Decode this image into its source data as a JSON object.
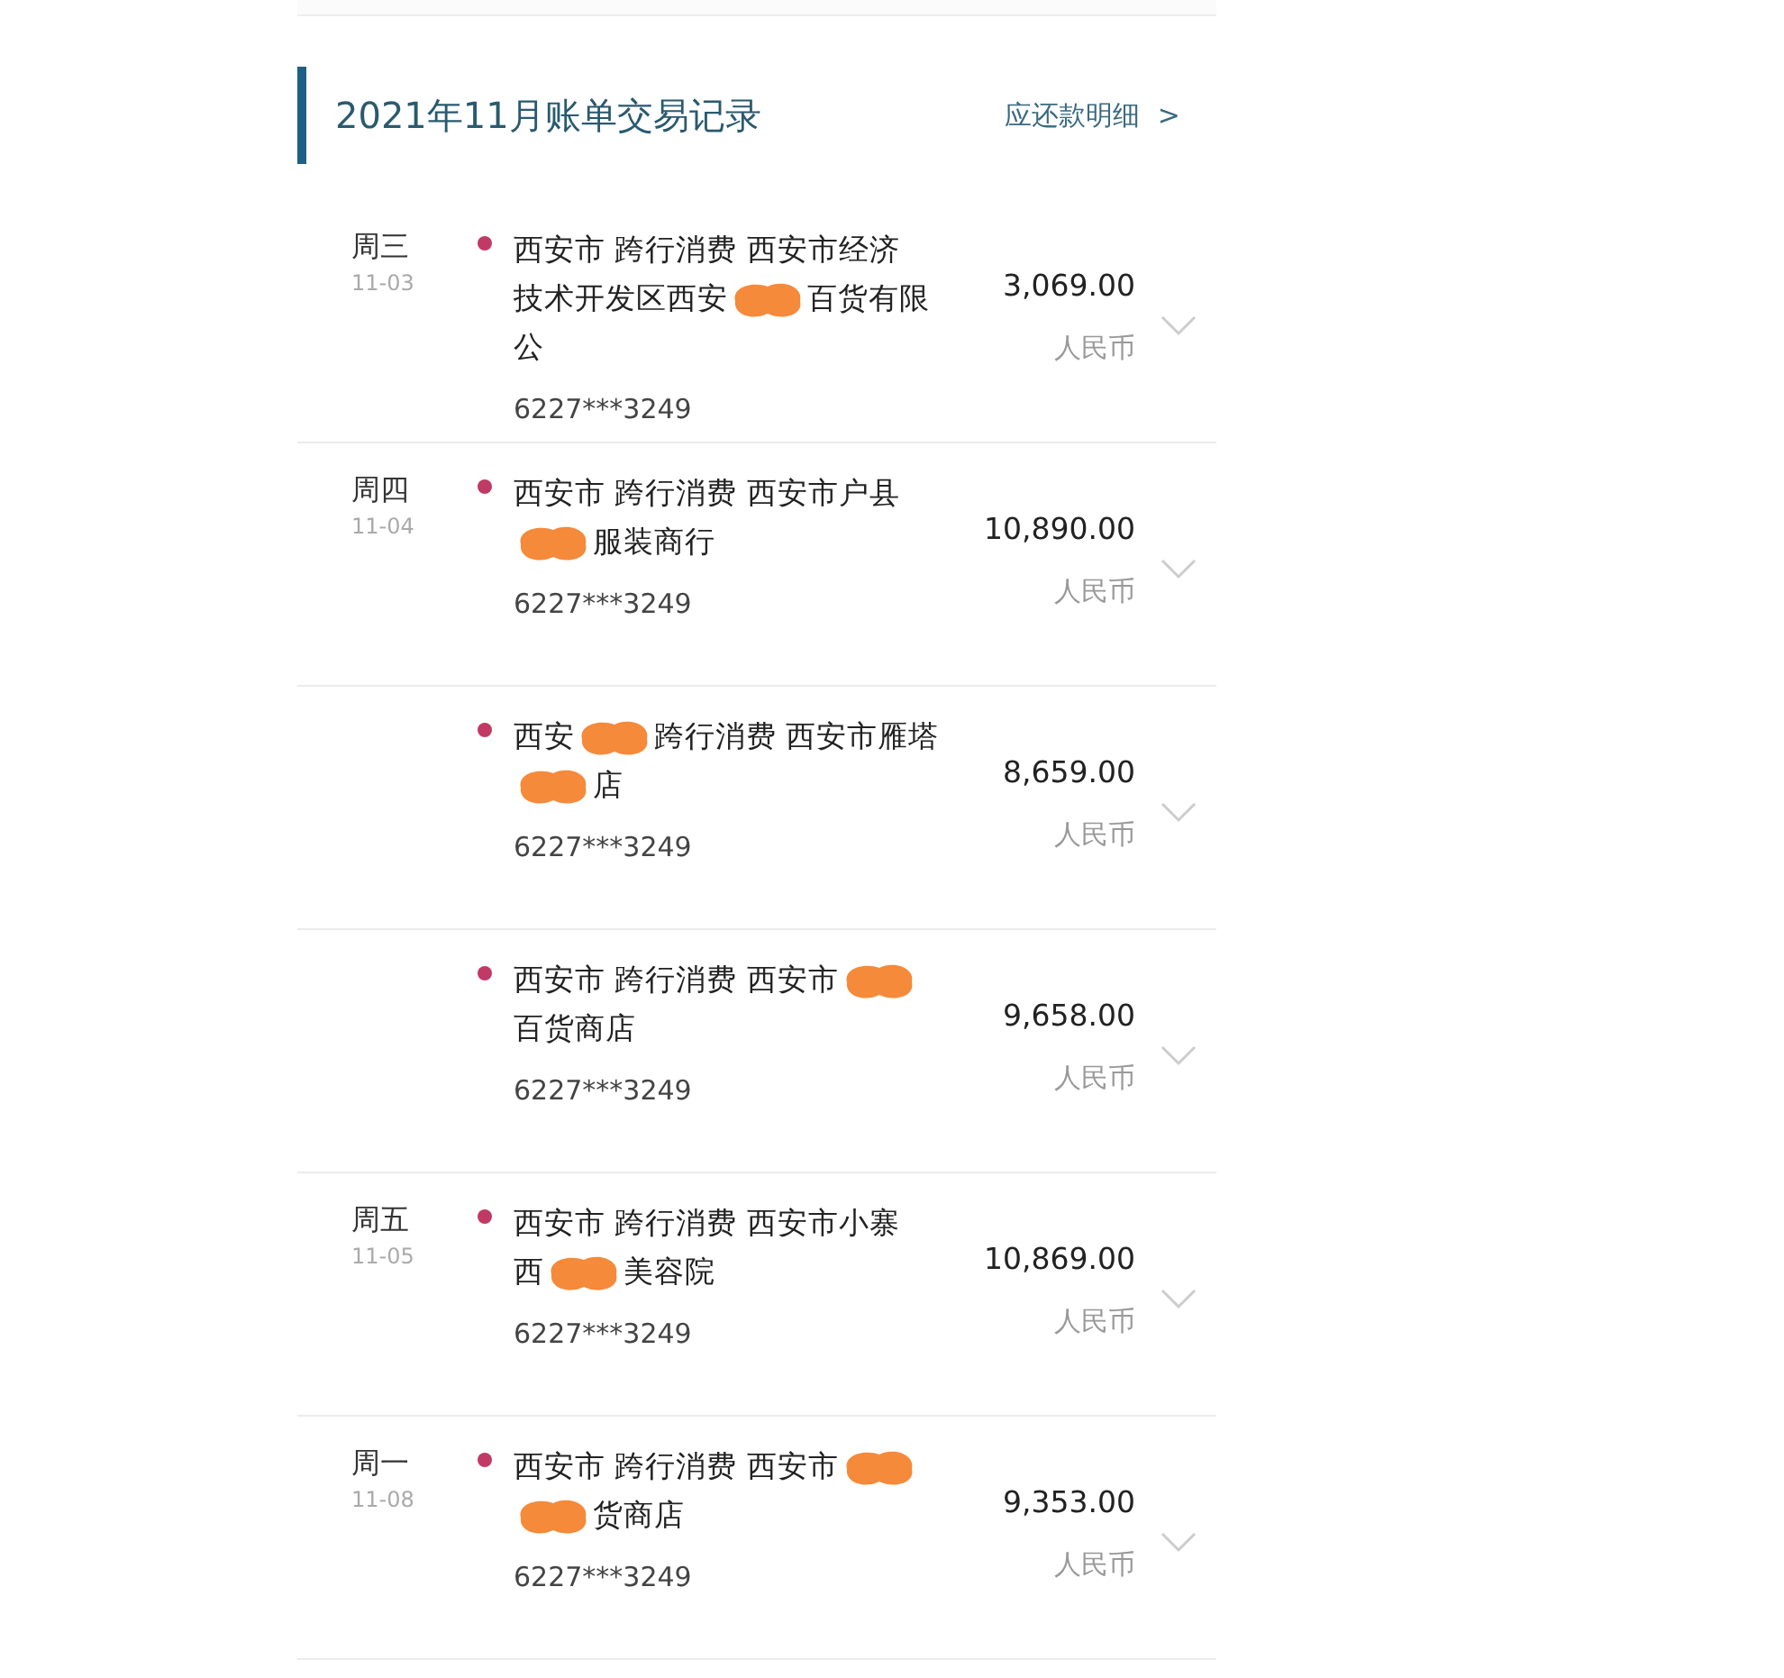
{
  "header": {
    "title": "2021年11月账单交易记录",
    "link": "应还款明细",
    "link_arrow": ">"
  },
  "transactions": [
    {
      "weekday": "周三",
      "date": "11-03",
      "lines": [
        [
          {
            "kind": "text",
            "text": "西安市 跨行消费 西安市经济"
          }
        ],
        [
          {
            "kind": "text",
            "text": "技术开发区西安"
          },
          {
            "kind": "redaction"
          },
          {
            "kind": "text",
            "text": "百货有限"
          }
        ],
        [
          {
            "kind": "text",
            "text": "公"
          }
        ]
      ],
      "account": "6227***3249",
      "amount": "3,069.00",
      "currency": "人民币"
    },
    {
      "weekday": "周四",
      "date": "11-04",
      "lines": [
        [
          {
            "kind": "text",
            "text": "西安市 跨行消费 西安市户县"
          }
        ],
        [
          {
            "kind": "redaction"
          },
          {
            "kind": "text",
            "text": "服装商行"
          }
        ]
      ],
      "account": "6227***3249",
      "amount": "10,890.00",
      "currency": "人民币"
    },
    {
      "lines": [
        [
          {
            "kind": "text",
            "text": "西安"
          },
          {
            "kind": "redaction"
          },
          {
            "kind": "text",
            "text": "跨行消费 西安市雁塔"
          }
        ],
        [
          {
            "kind": "redaction"
          },
          {
            "kind": "text",
            "text": "店"
          }
        ]
      ],
      "account": "6227***3249",
      "amount": "8,659.00",
      "currency": "人民币"
    },
    {
      "lines": [
        [
          {
            "kind": "text",
            "text": "西安市 跨行消费 西安市"
          },
          {
            "kind": "redaction"
          }
        ],
        [
          {
            "kind": "text",
            "text": "百货商店"
          }
        ]
      ],
      "account": "6227***3249",
      "amount": "9,658.00",
      "currency": "人民币"
    },
    {
      "weekday": "周五",
      "date": "11-05",
      "lines": [
        [
          {
            "kind": "text",
            "text": "西安市 跨行消费 西安市小寨"
          }
        ],
        [
          {
            "kind": "text",
            "text": "西"
          },
          {
            "kind": "redaction"
          },
          {
            "kind": "text",
            "text": "美容院"
          }
        ]
      ],
      "account": "6227***3249",
      "amount": "10,869.00",
      "currency": "人民币"
    },
    {
      "weekday": "周一",
      "date": "11-08",
      "lines": [
        [
          {
            "kind": "text",
            "text": "西安市 跨行消费 西安市"
          },
          {
            "kind": "redaction"
          }
        ],
        [
          {
            "kind": "redaction"
          },
          {
            "kind": "text",
            "text": "货商店"
          }
        ]
      ],
      "account": "6227***3249",
      "amount": "9,353.00",
      "currency": "人民币"
    }
  ]
}
